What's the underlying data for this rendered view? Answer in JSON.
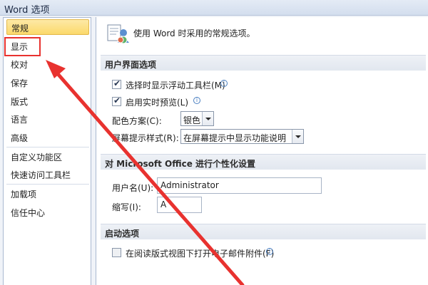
{
  "window": {
    "title": "Word 选项"
  },
  "sidebar": {
    "items": [
      {
        "label": "常规"
      },
      {
        "label": "显示"
      },
      {
        "label": "校对"
      },
      {
        "label": "保存"
      },
      {
        "label": "版式"
      },
      {
        "label": "语言"
      },
      {
        "label": "高级"
      },
      {
        "label": "自定义功能区"
      },
      {
        "label": "快速访问工具栏"
      },
      {
        "label": "加载项"
      },
      {
        "label": "信任中心"
      }
    ]
  },
  "main": {
    "intro": "使用 Word 时采用的常规选项。",
    "ui_section": {
      "header": "用户界面选项",
      "show_mini_toolbar": {
        "label": "选择时显示浮动工具栏(M)",
        "checked": true
      },
      "live_preview": {
        "label": "启用实时预览(L)",
        "checked": true
      },
      "color_scheme": {
        "label": "配色方案(C):",
        "value": "银色"
      },
      "screentip_style": {
        "label": "屏幕提示样式(R):",
        "value": "在屏幕提示中显示功能说明"
      }
    },
    "personalize_section": {
      "header": "对 Microsoft Office 进行个性化设置",
      "username": {
        "label": "用户名(U):",
        "value": "Administrator"
      },
      "initials": {
        "label": "缩写(I):",
        "value": "A"
      }
    },
    "startup_section": {
      "header": "启动选项",
      "open_reading_view": {
        "label": "在阅读版式视图下打开电子邮件附件(F)",
        "checked": false
      }
    }
  },
  "colors": {
    "active_nav": "#fbd96b",
    "annotation": "#e8322f"
  }
}
